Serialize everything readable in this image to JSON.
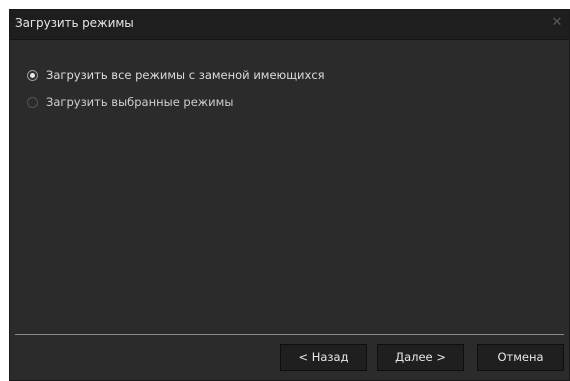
{
  "dialog": {
    "title": "Загрузить режимы",
    "close_glyph": "✕"
  },
  "options": [
    {
      "label": "Загрузить все режимы с заменой имеющихся",
      "selected": true
    },
    {
      "label": "Загрузить выбранные режимы",
      "selected": false
    }
  ],
  "buttons": {
    "back_label": "< Назад",
    "next_label": "Далее >",
    "cancel_label": "Отмена"
  },
  "colors": {
    "background": "#2b2b2b",
    "titlebar": "#1e1e1e",
    "button": "#1f1f1f",
    "text": "#dcdcdc"
  }
}
